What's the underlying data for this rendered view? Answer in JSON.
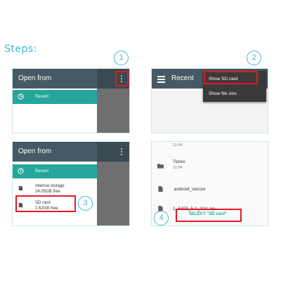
{
  "title": "Steps:",
  "steps": {
    "step1": {
      "number": "1",
      "app_title": "Open from",
      "recent_label": "Recent"
    },
    "step2": {
      "number": "2",
      "app_title": "Recent",
      "menu": [
        "Show SD card",
        "Show file size"
      ]
    },
    "step3": {
      "number": "3",
      "app_title": "Open from",
      "recent_label": "Recent",
      "internal_storage": {
        "name": "Internal storage",
        "free": "24.05GB free"
      },
      "sd_card": {
        "name": "SD card",
        "free": "2.62GB free"
      }
    },
    "step4": {
      "number": "4",
      "top_time": "11:04",
      "folder": {
        "name": "Tstore",
        "time": "11:04"
      },
      "secure": ".android_secure",
      "partial_file": "1_F400_5.0_20A.zip",
      "select_label": "SELECT \"SD card\""
    }
  },
  "colors": {
    "accent": "#3fb8d6",
    "teal": "#26a69a",
    "appbar": "#455a64",
    "highlight": "#e01b24"
  }
}
